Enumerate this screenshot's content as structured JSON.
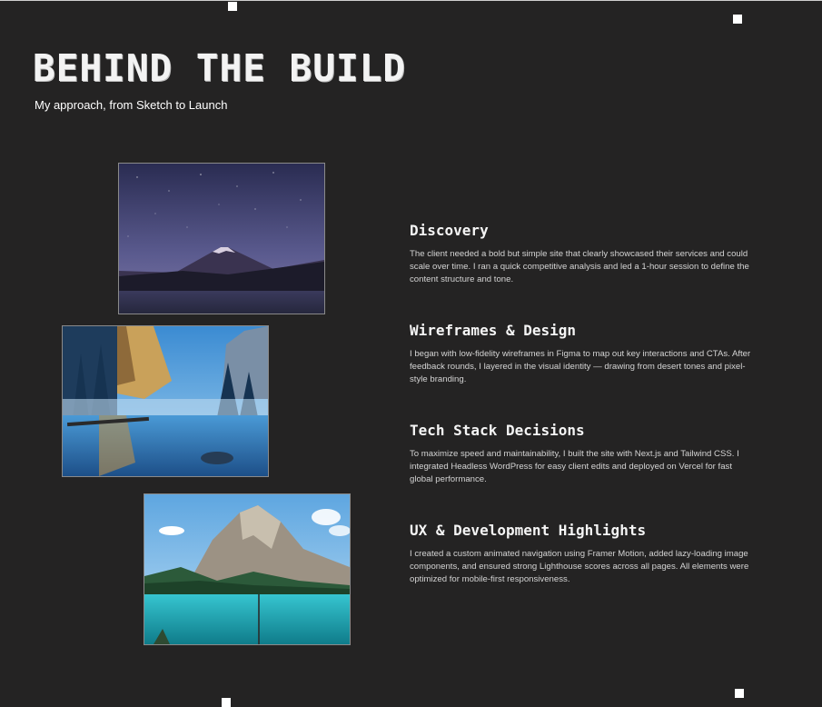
{
  "header": {
    "title": "BEHIND THE BUILD",
    "subtitle": "My approach, from Sketch to Launch"
  },
  "steps": [
    {
      "title": "Discovery",
      "text": "The client needed a bold but simple site that clearly showcased their services and could scale over time. I ran a quick competitive analysis and led a 1-hour session to define the content structure and tone."
    },
    {
      "title": "Wireframes & Design",
      "text": "I began with low-fidelity wireframes in Figma to map out key interactions and CTAs. After feedback rounds, I layered in the visual identity — drawing from desert tones and pixel-style branding."
    },
    {
      "title": "Tech Stack Decisions",
      "text": "To maximize speed and maintainability, I built the site with Next.js and Tailwind CSS. I integrated Headless WordPress for easy client edits and deployed on Vercel for fast global performance."
    },
    {
      "title": "UX & Development Highlights",
      "text": "I created a custom animated navigation using Framer Motion, added lazy-loading image components, and ensured strong Lighthouse scores across all pages. All elements were optimized for mobile-first responsiveness."
    }
  ],
  "colors": {
    "background": "#242323",
    "text": "#ffffff",
    "body_text": "#d4d4d4"
  }
}
